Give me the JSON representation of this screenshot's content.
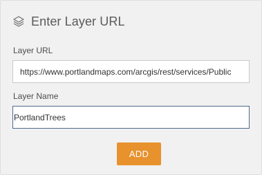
{
  "header": {
    "title": "Enter Layer URL",
    "icon": "layers-icon"
  },
  "layer_url": {
    "label": "Layer URL",
    "value": "https://www.portlandmaps.com/arcgis/rest/services/Public"
  },
  "layer_name": {
    "label": "Layer Name",
    "value": "PortlandTrees"
  },
  "add_button": {
    "label": "ADD"
  },
  "colors": {
    "accent": "#e8922d",
    "panel_background": "#f1f1f1",
    "focus_border": "#4d6b8c"
  }
}
